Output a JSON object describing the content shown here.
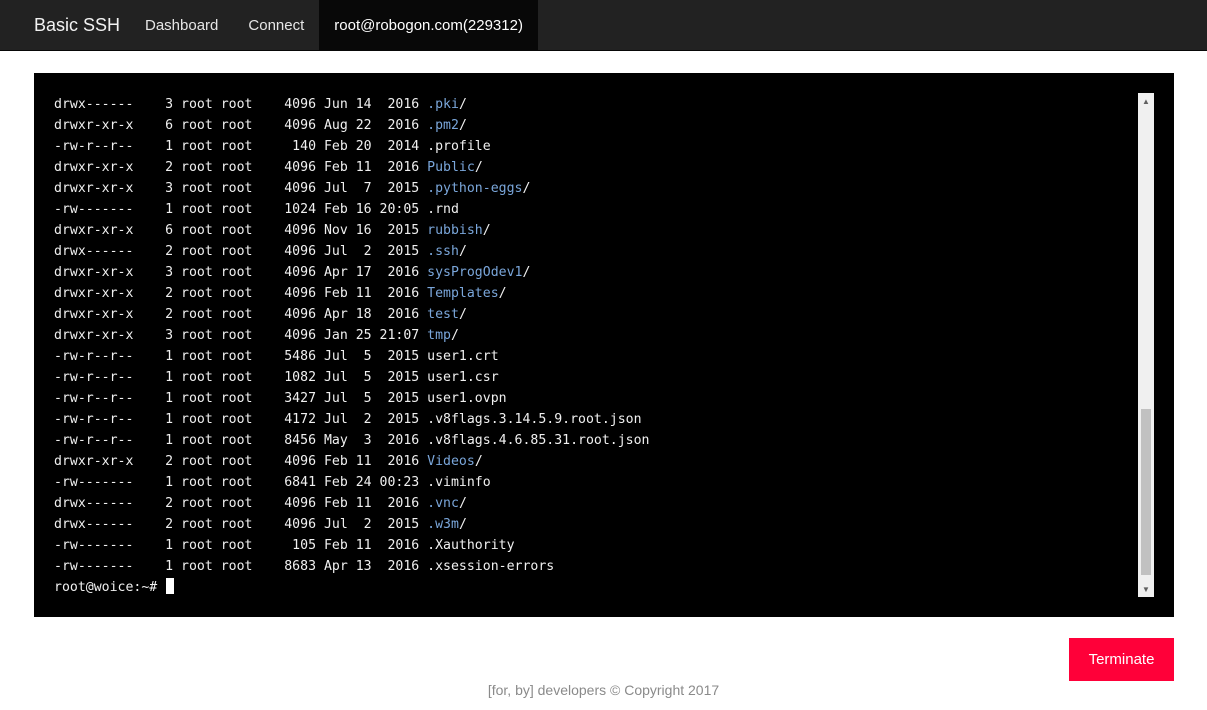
{
  "nav": {
    "brand": "Basic SSH",
    "items": [
      {
        "label": "Dashboard",
        "active": false
      },
      {
        "label": "Connect",
        "active": false
      },
      {
        "label": "root@robogon.com(229312)",
        "active": true
      }
    ]
  },
  "terminal": {
    "colors": {
      "background": "#000000",
      "text": "#f0f0f0",
      "directory": "#7aa6da"
    },
    "lines": [
      {
        "info": "drwx------    3 root root    4096 Jun 14  2016 ",
        "name": ".pki",
        "suffix": "/",
        "dir": true
      },
      {
        "info": "drwxr-xr-x    6 root root    4096 Aug 22  2016 ",
        "name": ".pm2",
        "suffix": "/",
        "dir": true
      },
      {
        "info": "-rw-r--r--    1 root root     140 Feb 20  2014 ",
        "name": ".profile",
        "suffix": "",
        "dir": false
      },
      {
        "info": "drwxr-xr-x    2 root root    4096 Feb 11  2016 ",
        "name": "Public",
        "suffix": "/",
        "dir": true
      },
      {
        "info": "drwxr-xr-x    3 root root    4096 Jul  7  2015 ",
        "name": ".python-eggs",
        "suffix": "/",
        "dir": true
      },
      {
        "info": "-rw-------    1 root root    1024 Feb 16 20:05 ",
        "name": ".rnd",
        "suffix": "",
        "dir": false
      },
      {
        "info": "drwxr-xr-x    6 root root    4096 Nov 16  2015 ",
        "name": "rubbish",
        "suffix": "/",
        "dir": true
      },
      {
        "info": "drwx------    2 root root    4096 Jul  2  2015 ",
        "name": ".ssh",
        "suffix": "/",
        "dir": true
      },
      {
        "info": "drwxr-xr-x    3 root root    4096 Apr 17  2016 ",
        "name": "sysProgOdev1",
        "suffix": "/",
        "dir": true
      },
      {
        "info": "drwxr-xr-x    2 root root    4096 Feb 11  2016 ",
        "name": "Templates",
        "suffix": "/",
        "dir": true
      },
      {
        "info": "drwxr-xr-x    2 root root    4096 Apr 18  2016 ",
        "name": "test",
        "suffix": "/",
        "dir": true
      },
      {
        "info": "drwxr-xr-x    3 root root    4096 Jan 25 21:07 ",
        "name": "tmp",
        "suffix": "/",
        "dir": true
      },
      {
        "info": "-rw-r--r--    1 root root    5486 Jul  5  2015 ",
        "name": "user1.crt",
        "suffix": "",
        "dir": false
      },
      {
        "info": "-rw-r--r--    1 root root    1082 Jul  5  2015 ",
        "name": "user1.csr",
        "suffix": "",
        "dir": false
      },
      {
        "info": "-rw-r--r--    1 root root    3427 Jul  5  2015 ",
        "name": "user1.ovpn",
        "suffix": "",
        "dir": false
      },
      {
        "info": "-rw-r--r--    1 root root    4172 Jul  2  2015 ",
        "name": ".v8flags.3.14.5.9.root.json",
        "suffix": "",
        "dir": false
      },
      {
        "info": "-rw-r--r--    1 root root    8456 May  3  2016 ",
        "name": ".v8flags.4.6.85.31.root.json",
        "suffix": "",
        "dir": false
      },
      {
        "info": "drwxr-xr-x    2 root root    4096 Feb 11  2016 ",
        "name": "Videos",
        "suffix": "/",
        "dir": true
      },
      {
        "info": "-rw-------    1 root root    6841 Feb 24 00:23 ",
        "name": ".viminfo",
        "suffix": "",
        "dir": false
      },
      {
        "info": "drwx------    2 root root    4096 Feb 11  2016 ",
        "name": ".vnc",
        "suffix": "/",
        "dir": true
      },
      {
        "info": "drwx------    2 root root    4096 Jul  2  2015 ",
        "name": ".w3m",
        "suffix": "/",
        "dir": true
      },
      {
        "info": "-rw-------    1 root root     105 Feb 11  2016 ",
        "name": ".Xauthority",
        "suffix": "",
        "dir": false
      },
      {
        "info": "-rw-------    1 root root    8683 Apr 13  2016 ",
        "name": ".xsession-errors",
        "suffix": "",
        "dir": false
      }
    ],
    "prompt": "root@woice:~# "
  },
  "scrollbar": {
    "position_fraction": 0.98
  },
  "actions": {
    "terminate_label": "Terminate",
    "terminate_color": "#ff0039"
  },
  "footer": {
    "text": "[for, by] developers © Copyright 2017"
  }
}
